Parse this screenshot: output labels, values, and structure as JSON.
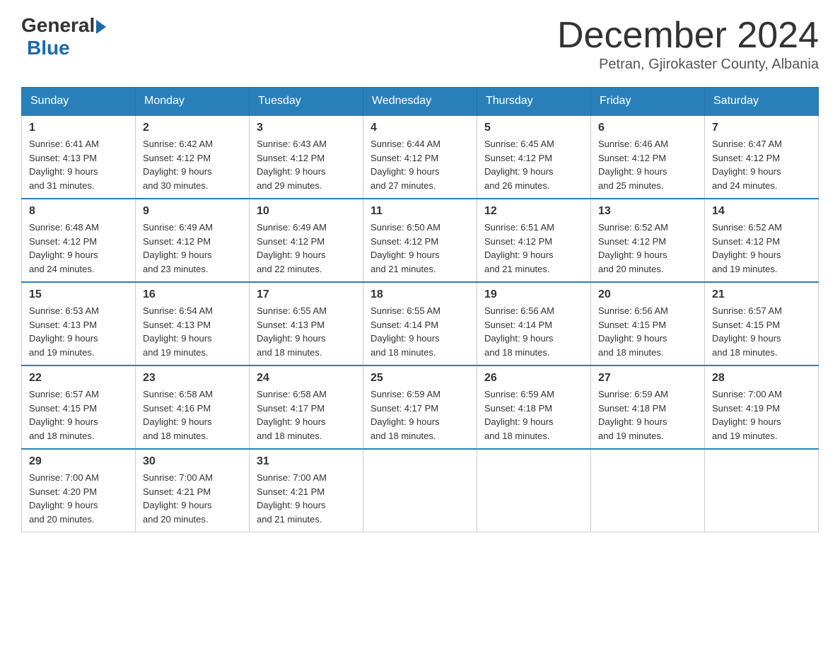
{
  "header": {
    "logo_general": "General",
    "logo_blue": "Blue",
    "title": "December 2024",
    "location": "Petran, Gjirokaster County, Albania"
  },
  "weekdays": [
    "Sunday",
    "Monday",
    "Tuesday",
    "Wednesday",
    "Thursday",
    "Friday",
    "Saturday"
  ],
  "weeks": [
    [
      {
        "day": 1,
        "sunrise": "6:41 AM",
        "sunset": "4:13 PM",
        "daylight": "9 hours and 31 minutes."
      },
      {
        "day": 2,
        "sunrise": "6:42 AM",
        "sunset": "4:12 PM",
        "daylight": "9 hours and 30 minutes."
      },
      {
        "day": 3,
        "sunrise": "6:43 AM",
        "sunset": "4:12 PM",
        "daylight": "9 hours and 29 minutes."
      },
      {
        "day": 4,
        "sunrise": "6:44 AM",
        "sunset": "4:12 PM",
        "daylight": "9 hours and 27 minutes."
      },
      {
        "day": 5,
        "sunrise": "6:45 AM",
        "sunset": "4:12 PM",
        "daylight": "9 hours and 26 minutes."
      },
      {
        "day": 6,
        "sunrise": "6:46 AM",
        "sunset": "4:12 PM",
        "daylight": "9 hours and 25 minutes."
      },
      {
        "day": 7,
        "sunrise": "6:47 AM",
        "sunset": "4:12 PM",
        "daylight": "9 hours and 24 minutes."
      }
    ],
    [
      {
        "day": 8,
        "sunrise": "6:48 AM",
        "sunset": "4:12 PM",
        "daylight": "9 hours and 24 minutes."
      },
      {
        "day": 9,
        "sunrise": "6:49 AM",
        "sunset": "4:12 PM",
        "daylight": "9 hours and 23 minutes."
      },
      {
        "day": 10,
        "sunrise": "6:49 AM",
        "sunset": "4:12 PM",
        "daylight": "9 hours and 22 minutes."
      },
      {
        "day": 11,
        "sunrise": "6:50 AM",
        "sunset": "4:12 PM",
        "daylight": "9 hours and 21 minutes."
      },
      {
        "day": 12,
        "sunrise": "6:51 AM",
        "sunset": "4:12 PM",
        "daylight": "9 hours and 21 minutes."
      },
      {
        "day": 13,
        "sunrise": "6:52 AM",
        "sunset": "4:12 PM",
        "daylight": "9 hours and 20 minutes."
      },
      {
        "day": 14,
        "sunrise": "6:52 AM",
        "sunset": "4:12 PM",
        "daylight": "9 hours and 19 minutes."
      }
    ],
    [
      {
        "day": 15,
        "sunrise": "6:53 AM",
        "sunset": "4:13 PM",
        "daylight": "9 hours and 19 minutes."
      },
      {
        "day": 16,
        "sunrise": "6:54 AM",
        "sunset": "4:13 PM",
        "daylight": "9 hours and 19 minutes."
      },
      {
        "day": 17,
        "sunrise": "6:55 AM",
        "sunset": "4:13 PM",
        "daylight": "9 hours and 18 minutes."
      },
      {
        "day": 18,
        "sunrise": "6:55 AM",
        "sunset": "4:14 PM",
        "daylight": "9 hours and 18 minutes."
      },
      {
        "day": 19,
        "sunrise": "6:56 AM",
        "sunset": "4:14 PM",
        "daylight": "9 hours and 18 minutes."
      },
      {
        "day": 20,
        "sunrise": "6:56 AM",
        "sunset": "4:15 PM",
        "daylight": "9 hours and 18 minutes."
      },
      {
        "day": 21,
        "sunrise": "6:57 AM",
        "sunset": "4:15 PM",
        "daylight": "9 hours and 18 minutes."
      }
    ],
    [
      {
        "day": 22,
        "sunrise": "6:57 AM",
        "sunset": "4:15 PM",
        "daylight": "9 hours and 18 minutes."
      },
      {
        "day": 23,
        "sunrise": "6:58 AM",
        "sunset": "4:16 PM",
        "daylight": "9 hours and 18 minutes."
      },
      {
        "day": 24,
        "sunrise": "6:58 AM",
        "sunset": "4:17 PM",
        "daylight": "9 hours and 18 minutes."
      },
      {
        "day": 25,
        "sunrise": "6:59 AM",
        "sunset": "4:17 PM",
        "daylight": "9 hours and 18 minutes."
      },
      {
        "day": 26,
        "sunrise": "6:59 AM",
        "sunset": "4:18 PM",
        "daylight": "9 hours and 18 minutes."
      },
      {
        "day": 27,
        "sunrise": "6:59 AM",
        "sunset": "4:18 PM",
        "daylight": "9 hours and 19 minutes."
      },
      {
        "day": 28,
        "sunrise": "7:00 AM",
        "sunset": "4:19 PM",
        "daylight": "9 hours and 19 minutes."
      }
    ],
    [
      {
        "day": 29,
        "sunrise": "7:00 AM",
        "sunset": "4:20 PM",
        "daylight": "9 hours and 20 minutes."
      },
      {
        "day": 30,
        "sunrise": "7:00 AM",
        "sunset": "4:21 PM",
        "daylight": "9 hours and 20 minutes."
      },
      {
        "day": 31,
        "sunrise": "7:00 AM",
        "sunset": "4:21 PM",
        "daylight": "9 hours and 21 minutes."
      },
      null,
      null,
      null,
      null
    ]
  ],
  "labels": {
    "sunrise": "Sunrise:",
    "sunset": "Sunset:",
    "daylight": "Daylight:"
  }
}
